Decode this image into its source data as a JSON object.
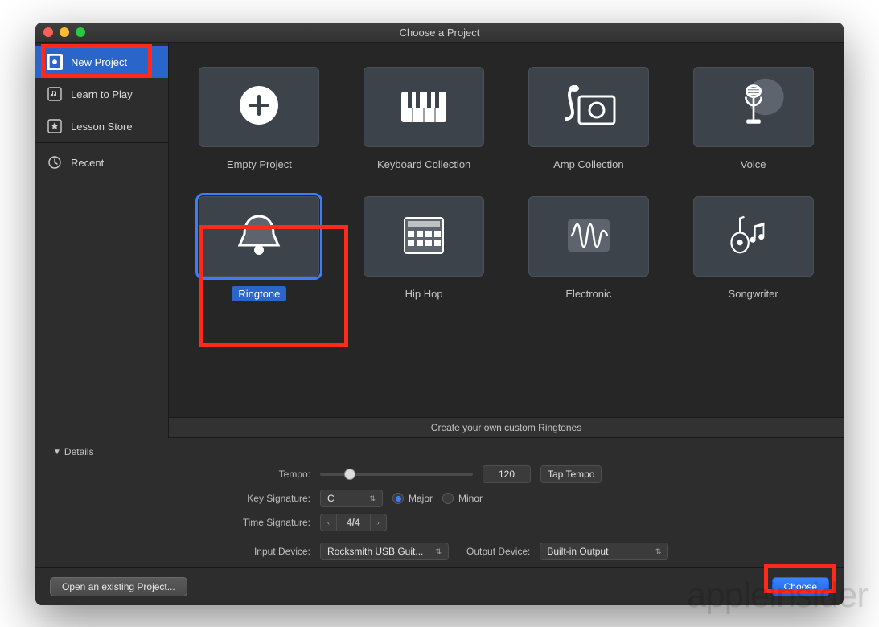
{
  "window": {
    "title": "Choose a Project"
  },
  "sidebar": {
    "items": [
      {
        "label": "New Project",
        "icon": "circle-doc",
        "active": true
      },
      {
        "label": "Learn to Play",
        "icon": "note-doc",
        "active": false
      },
      {
        "label": "Lesson Store",
        "icon": "star-box",
        "active": false
      },
      {
        "label": "Recent",
        "icon": "clock",
        "active": false
      }
    ]
  },
  "templates": [
    {
      "label": "Empty Project",
      "icon": "plus",
      "selected": false
    },
    {
      "label": "Keyboard Collection",
      "icon": "keyboard",
      "selected": false
    },
    {
      "label": "Amp Collection",
      "icon": "amp",
      "selected": false
    },
    {
      "label": "Voice",
      "icon": "mic",
      "selected": false
    },
    {
      "label": "Ringtone",
      "icon": "bell",
      "selected": true
    },
    {
      "label": "Hip Hop",
      "icon": "mpc",
      "selected": false
    },
    {
      "label": "Electronic",
      "icon": "wave",
      "selected": false
    },
    {
      "label": "Songwriter",
      "icon": "guitar-notes",
      "selected": false
    }
  ],
  "info_strip": "Create your own custom Ringtones",
  "details": {
    "header": "Details",
    "tempo_label": "Tempo:",
    "tempo_value": "120",
    "tap_tempo": "Tap Tempo",
    "key_sig_label": "Key Signature:",
    "key_value": "C",
    "major": "Major",
    "minor": "Minor",
    "major_selected": true,
    "time_sig_label": "Time Signature:",
    "time_sig_value": "4/4",
    "input_device_label": "Input Device:",
    "input_device_value": "Rocksmith USB Guit...",
    "output_device_label": "Output Device:",
    "output_device_value": "Built-in Output"
  },
  "footer": {
    "open_existing": "Open an existing Project...",
    "choose": "Choose"
  },
  "watermark": {
    "part1": "apple",
    "part2": "insider"
  }
}
